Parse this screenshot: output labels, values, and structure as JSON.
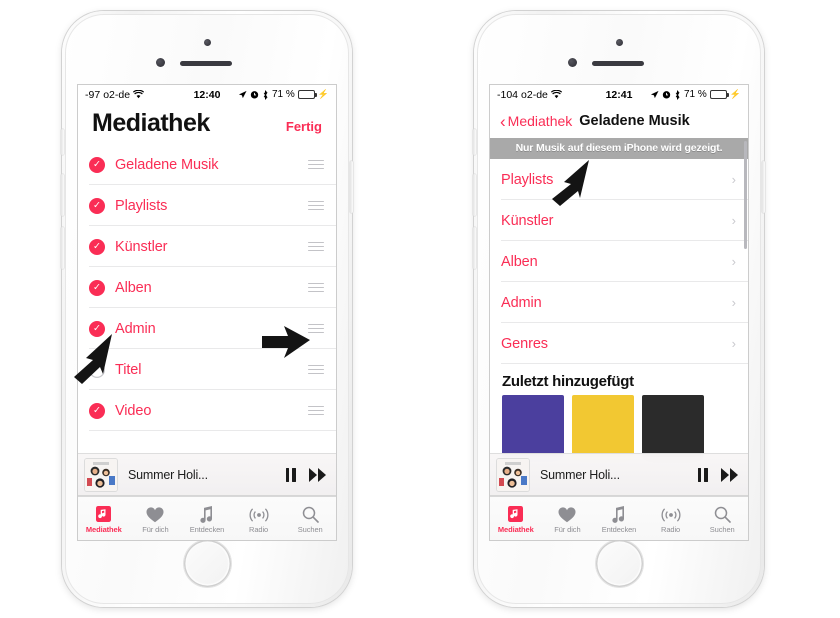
{
  "accent_color": "#fa2d55",
  "phones": [
    {
      "id": "left",
      "status_bar": {
        "signal": "-97",
        "carrier": "o2-de",
        "wifi_icon": "wifi-icon",
        "time": "12:40",
        "location_icon": "location-arrow-icon",
        "alarm_icon": "alarm-clock-icon",
        "bluetooth_icon": "bluetooth-icon",
        "battery_percent": "71 %",
        "charging_icon": "lightning-bolt-icon"
      },
      "nav": {
        "title": "Mediathek",
        "done_label": "Fertig"
      },
      "list_items": [
        {
          "label": "Geladene Musik",
          "checked": true
        },
        {
          "label": "Playlists",
          "checked": true
        },
        {
          "label": "Künstler",
          "checked": true
        },
        {
          "label": "Alben",
          "checked": true
        },
        {
          "label": "Admin",
          "checked": true
        },
        {
          "label": "Titel",
          "checked": false
        },
        {
          "label": "Video",
          "checked": true
        }
      ],
      "now_playing": {
        "track_title": "Summer Holi...",
        "pause_icon": "pause-icon",
        "next_icon": "fast-forward-icon",
        "artwork": "album-artwork"
      },
      "tabs": [
        {
          "label": "Mediathek",
          "icon": "library-icon",
          "active": true
        },
        {
          "label": "Für dich",
          "icon": "heart-icon",
          "active": false
        },
        {
          "label": "Entdecken",
          "icon": "music-note-icon",
          "active": false
        },
        {
          "label": "Radio",
          "icon": "radio-waves-icon",
          "active": false
        },
        {
          "label": "Suchen",
          "icon": "search-icon",
          "active": false
        }
      ]
    },
    {
      "id": "right",
      "status_bar": {
        "signal": "-104",
        "carrier": "o2-de",
        "wifi_icon": "wifi-icon",
        "time": "12:41",
        "location_icon": "location-arrow-icon",
        "alarm_icon": "alarm-clock-icon",
        "bluetooth_icon": "bluetooth-icon",
        "battery_percent": "71 %",
        "charging_icon": "lightning-bolt-icon"
      },
      "nav": {
        "back_label": "Mediathek",
        "title": "Geladene Musik",
        "back_icon": "chevron-left-icon"
      },
      "banner": "Nur Musik auf diesem iPhone wird gezeigt.",
      "list_items": [
        {
          "label": "Playlists"
        },
        {
          "label": "Künstler"
        },
        {
          "label": "Alben"
        },
        {
          "label": "Admin"
        },
        {
          "label": "Genres"
        }
      ],
      "section": {
        "heading": "Zuletzt hinzugefügt",
        "album_colors": [
          "#4b3f9e",
          "#f2c832",
          "#2b2b2b"
        ]
      },
      "now_playing": {
        "track_title": "Summer Holi...",
        "pause_icon": "pause-icon",
        "next_icon": "fast-forward-icon",
        "artwork": "album-artwork"
      },
      "tabs": [
        {
          "label": "Mediathek",
          "icon": "library-icon",
          "active": true
        },
        {
          "label": "Für dich",
          "icon": "heart-icon",
          "active": false
        },
        {
          "label": "Entdecken",
          "icon": "music-note-icon",
          "active": false
        },
        {
          "label": "Radio",
          "icon": "radio-waves-icon",
          "active": false
        },
        {
          "label": "Suchen",
          "icon": "search-icon",
          "active": false
        }
      ]
    }
  ],
  "annotations": [
    {
      "name": "arrow-pointing-to-admin-checkbox",
      "direction": "up-right"
    },
    {
      "name": "arrow-pointing-to-reorder-handle",
      "direction": "right"
    },
    {
      "name": "arrow-pointing-to-banner",
      "direction": "up-right"
    }
  ]
}
